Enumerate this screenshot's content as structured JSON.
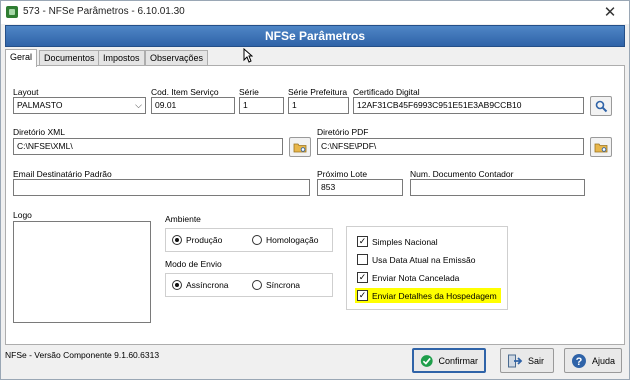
{
  "window": {
    "title": "573 - NFSe Parâmetros - 6.10.01.30",
    "banner": "NFSe Parâmetros"
  },
  "tabs": [
    "Geral",
    "Documentos",
    "Impostos",
    "Observações"
  ],
  "fields": {
    "layout": {
      "label": "Layout",
      "value": "PALMASTO"
    },
    "cod_item": {
      "label": "Cod. Item Serviço",
      "value": "09.01"
    },
    "serie": {
      "label": "Série",
      "value": "1"
    },
    "serie_prefeitura": {
      "label": "Série Prefeitura",
      "value": "1"
    },
    "certificado": {
      "label": "Certificado Digital",
      "value": "12AF31CB45F6993C951E51E3AB9CCB10"
    },
    "diretorio_xml": {
      "label": "Diretório XML",
      "value": "C:\\NFSE\\XML\\"
    },
    "diretorio_pdf": {
      "label": "Diretório PDF",
      "value": "C:\\NFSE\\PDF\\"
    },
    "email": {
      "label": "Email Destinatário Padrão",
      "value": ""
    },
    "proximo_lote": {
      "label": "Próximo Lote",
      "value": "853"
    },
    "num_documento": {
      "label": "Num. Documento Contador",
      "value": ""
    }
  },
  "logo_label": "Logo",
  "ambiente": {
    "label": "Ambiente",
    "options": [
      "Produção",
      "Homologação"
    ],
    "selected": "Produção"
  },
  "modo_envio": {
    "label": "Modo de Envio",
    "options": [
      "Assíncrona",
      "Síncrona"
    ],
    "selected": "Assíncrona"
  },
  "checkboxes": [
    {
      "label": "Simples Nacional",
      "checked": true
    },
    {
      "label": "Usa Data Atual na Emissão",
      "checked": false
    },
    {
      "label": "Enviar Nota Cancelada",
      "checked": true
    },
    {
      "label": "Enviar Detalhes da Hospedagem",
      "checked": true,
      "highlighted": true
    }
  ],
  "status": "NFSe - Versão Componente 9.1.60.6313",
  "buttons": {
    "confirmar": "Confirmar",
    "sair": "Sair",
    "ajuda": "Ajuda"
  },
  "colors": {
    "banner": "#3a70b4",
    "highlight": "#ffff00",
    "confirm_icon": "#1e9e4a",
    "help_icon": "#2f63a8"
  }
}
